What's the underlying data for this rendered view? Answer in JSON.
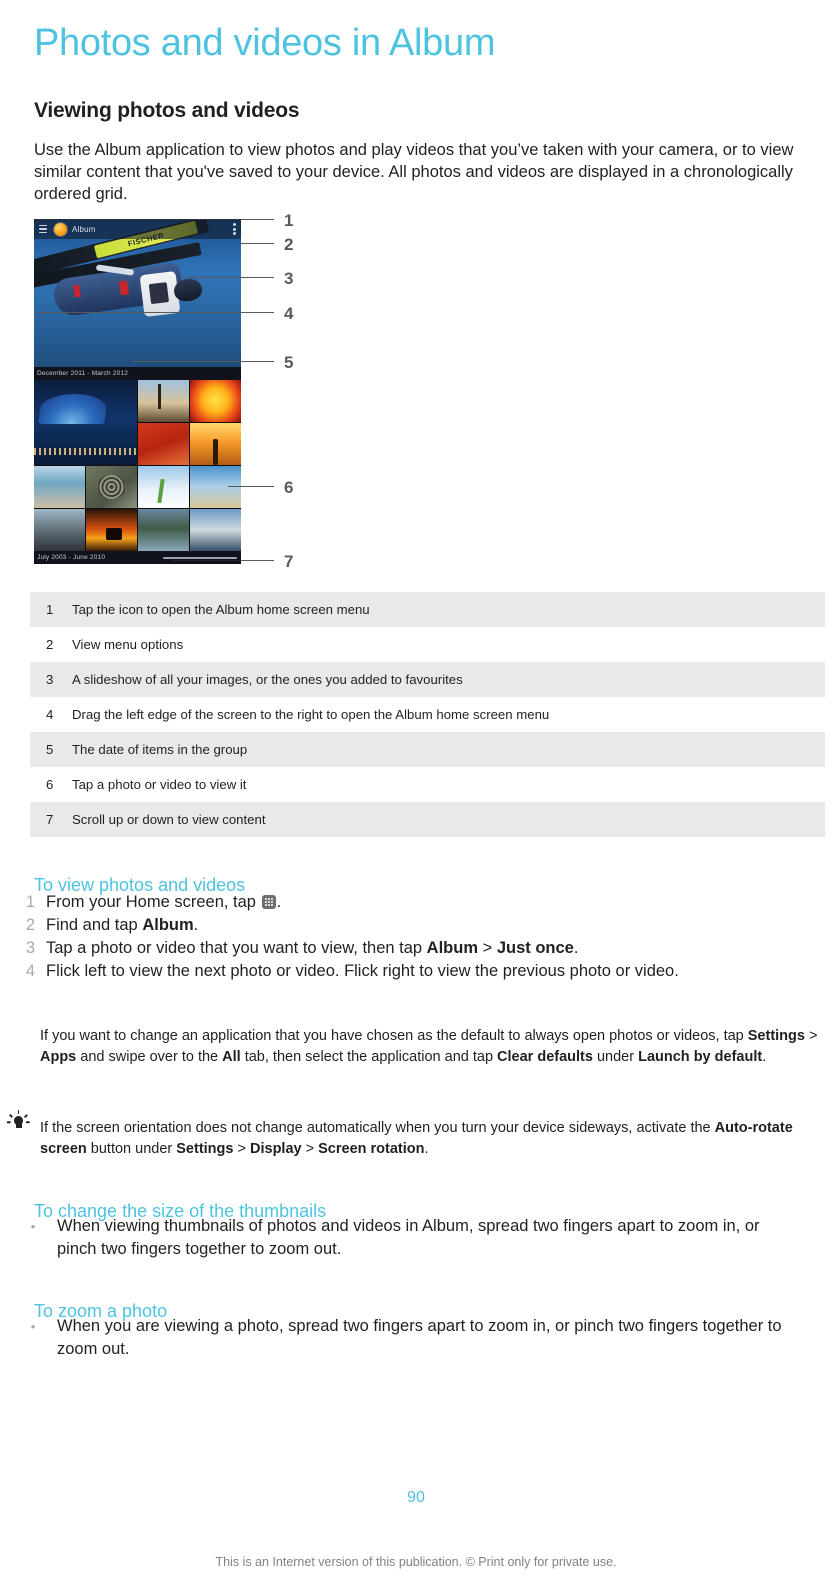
{
  "colors": {
    "accent": "#4ec3e0",
    "text": "#231f20",
    "muted": "#808285",
    "row_shade": "#e9e9e9"
  },
  "page_title": "Photos and videos in Album",
  "section": {
    "heading": "Viewing photos and videos",
    "intro": "Use the Album application to view photos and play videos that you’ve taken with your camera, or to view similar content that you've saved to your device. All photos and videos are displayed in a chronologically ordered grid."
  },
  "figure": {
    "app_name": "Album",
    "date_band_top": "December 2011 - March 2012",
    "date_band_bottom": "July 2003 - June 2010",
    "callouts": [
      "1",
      "2",
      "3",
      "4",
      "5",
      "6",
      "7"
    ]
  },
  "legend": {
    "rows": [
      {
        "num": "1",
        "text": "Tap the icon to open the Album home screen menu"
      },
      {
        "num": "2",
        "text": "View menu options"
      },
      {
        "num": "3",
        "text": "A slideshow of all your images, or the ones you added to favourites"
      },
      {
        "num": "4",
        "text": "Drag the left edge of the screen to the right to open the Album home screen menu"
      },
      {
        "num": "5",
        "text": "The date of items in the group"
      },
      {
        "num": "6",
        "text": "Tap a photo or video to view it"
      },
      {
        "num": "7",
        "text": "Scroll up or down to view content"
      }
    ]
  },
  "proc_view": {
    "title": "To view photos and videos",
    "steps": [
      {
        "num": "1",
        "pre": "From your Home screen, tap ",
        "icon": "apps-grid-icon",
        "post": "."
      },
      {
        "num": "2",
        "pre": "Find and tap ",
        "bold": "Album",
        "post": "."
      },
      {
        "num": "3",
        "pre": "Tap a photo or video that you want to view, then tap ",
        "bold": "Album",
        "mid": " > ",
        "bold2": "Just once",
        "post": "."
      },
      {
        "num": "4",
        "pre": "Flick left to view the next photo or video. Flick right to view the previous photo or video.",
        "post": ""
      }
    ]
  },
  "note_warning": {
    "icon": "exclamation-icon",
    "p1": "If you want to change an application that you have chosen as the default to always open photos or videos, tap ",
    "b1": "Settings",
    "p2": " > ",
    "b2": "Apps",
    "p3": " and swipe over to the ",
    "b3": "All",
    "p4": " tab, then select the application and tap ",
    "b4": "Clear defaults",
    "p5": " under ",
    "b5": "Launch by default",
    "p6": "."
  },
  "note_tip": {
    "icon": "lightbulb-icon",
    "p1": "If the screen orientation does not change automatically when you turn your device sideways, activate the ",
    "b1": "Auto-rotate screen",
    "p2": " button under ",
    "b2": "Settings",
    "p3": " > ",
    "b3": "Display",
    "p4": " > ",
    "b4": "Screen rotation",
    "p5": "."
  },
  "proc_thumbnails": {
    "title": "To change the size of the thumbnails",
    "bullet": "When viewing thumbnails of photos and videos in Album, spread two fingers apart to zoom in, or pinch two fingers together to zoom out."
  },
  "proc_zoom": {
    "title": "To zoom a photo",
    "bullet": "When you are viewing a photo, spread two fingers apart to zoom in, or pinch two fingers together to zoom out."
  },
  "footer": {
    "page_number": "90",
    "note": "This is an Internet version of this publication. © Print only for private use."
  }
}
